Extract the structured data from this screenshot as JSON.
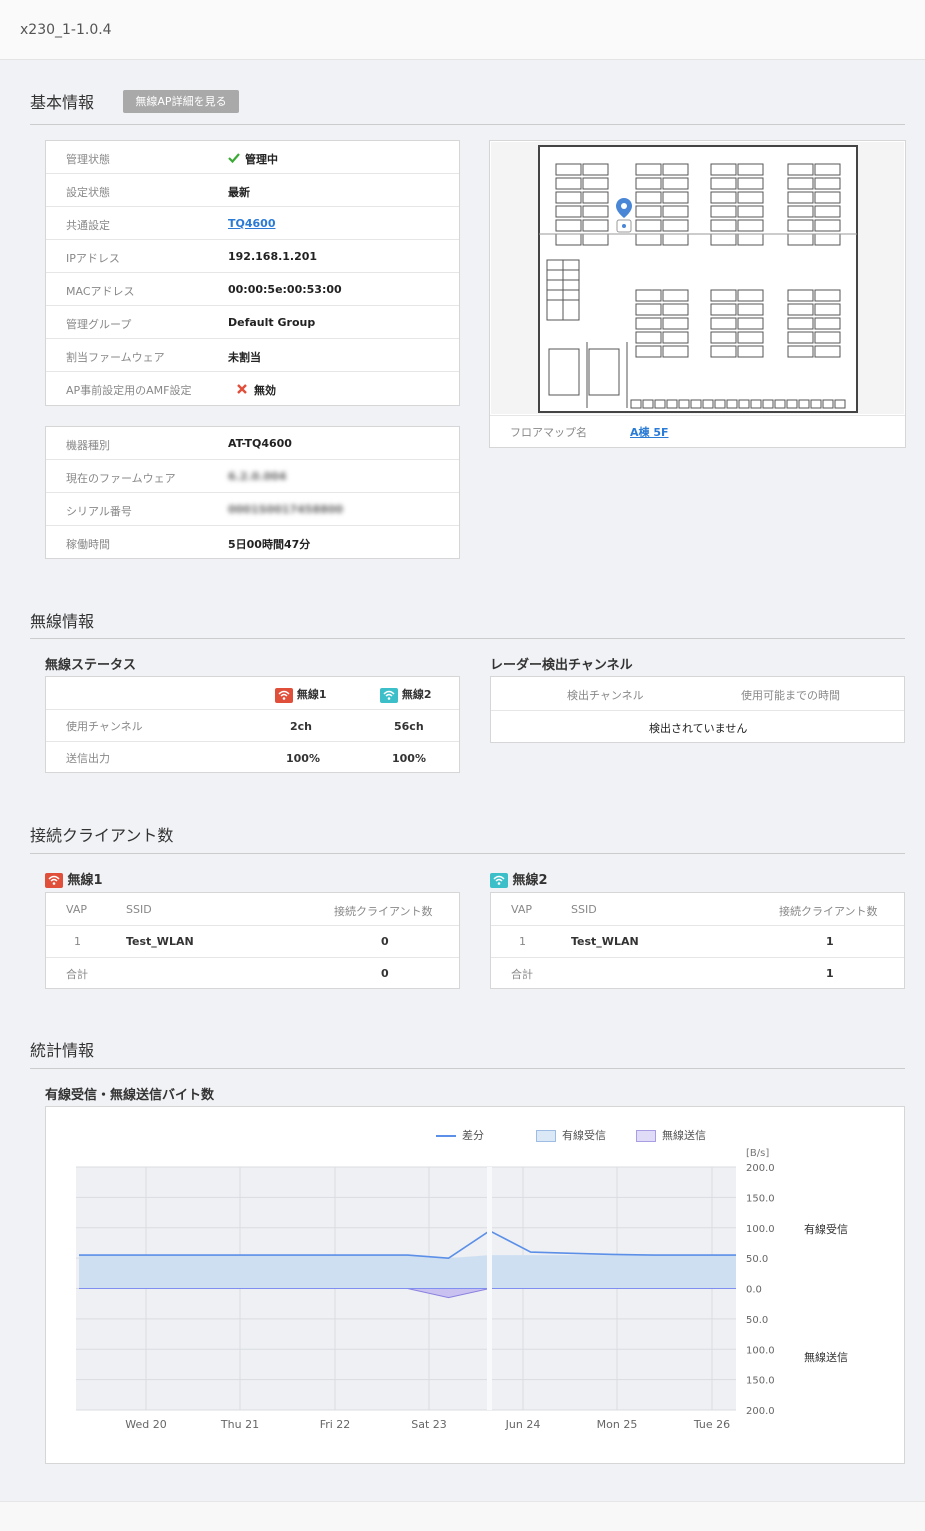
{
  "app": {
    "title": "x230_1-1.0.4"
  },
  "basic": {
    "section_title": "基本情報",
    "detail_button": "無線AP詳細を見る",
    "rows1": [
      {
        "label": "管理状態",
        "value": "管理中"
      },
      {
        "label": "設定状態",
        "value": "最新"
      },
      {
        "label": "共通設定",
        "value": "TQ4600"
      },
      {
        "label": "IPアドレス",
        "value": "192.168.1.201"
      },
      {
        "label": "MACアドレス",
        "value": "00:00:5e:00:53:00"
      },
      {
        "label": "管理グループ",
        "value": "Default Group"
      },
      {
        "label": "割当ファームウェア",
        "value": "未割当"
      },
      {
        "label": "AP事前設定用のAMF設定",
        "value": "無効"
      }
    ],
    "rows2": [
      {
        "label": "機器種別",
        "value": "AT-TQ4600"
      },
      {
        "label": "現在のファームウェア",
        "value": "6.2.0.004"
      },
      {
        "label": "シリアル番号",
        "value": "0001S0017458800"
      },
      {
        "label": "稼働時間",
        "value": "5日00時間47分"
      }
    ],
    "floormap": {
      "label": "フロアマップ名",
      "value": "A棟 5F"
    }
  },
  "wireless": {
    "section_title": "無線情報",
    "status_title": "無線ステータス",
    "radio1": "無線1",
    "radio2": "無線2",
    "rows": [
      {
        "label": "使用チャンネル",
        "r1": "2ch",
        "r2": "56ch"
      },
      {
        "label": "送信出力",
        "r1": "100%",
        "r2": "100%"
      }
    ],
    "radar_title": "レーダー検出チャンネル",
    "radar_col1": "検出チャンネル",
    "radar_col2": "使用可能までの時間",
    "radar_empty": "検出されていません"
  },
  "clients": {
    "section_title": "接続クライアント数",
    "col_vap": "VAP",
    "col_ssid": "SSID",
    "col_count": "接続クライアント数",
    "total_label": "合計",
    "radio1": {
      "name": "無線1",
      "vap": "1",
      "ssid": "Test_WLAN",
      "count": "0",
      "total": "0"
    },
    "radio2": {
      "name": "無線2",
      "vap": "1",
      "ssid": "Test_WLAN",
      "count": "1",
      "total": "1"
    }
  },
  "stats": {
    "section_title": "統計情報",
    "chart_title": "有線受信・無線送信バイト数",
    "legend_diff": "差分",
    "legend_rx": "有線受信",
    "legend_tx": "無線送信",
    "unit": "[B/s]",
    "side_rx": "有線受信",
    "side_tx": "無線送信"
  },
  "colors": {
    "accent_link": "#2a7bd6",
    "check_green": "#3aaa35",
    "cross_red": "#e04f3a",
    "radio1": "#e04f3a",
    "radio2": "#3cbfc9",
    "line": "#5b8fe8",
    "rx_fill": "#cfdff2",
    "tx_fill": "#d9d3f5"
  },
  "chart_data": {
    "type": "area",
    "ylabel": "[B/s]",
    "x_ticks": [
      "Wed 20",
      "Thu 21",
      "Fri 22",
      "Sat 23",
      "Jun 24",
      "Mon 25",
      "Tue 26"
    ],
    "y_ticks_upper": [
      "200.0",
      "150.0",
      "100.0",
      "50.0",
      "0.0"
    ],
    "y_ticks_lower": [
      "50.0",
      "100.0",
      "150.0",
      "200.0"
    ],
    "ylim": [
      -200,
      200
    ],
    "series": [
      {
        "name": "有線受信",
        "values": [
          55,
          55,
          55,
          55,
          55,
          55,
          55,
          55,
          55,
          50,
          55,
          55,
          55,
          55,
          55,
          55,
          55
        ]
      },
      {
        "name": "無線送信",
        "values": [
          0,
          0,
          0,
          0,
          0,
          0,
          0,
          0,
          0,
          -15,
          0,
          0,
          0,
          0,
          0,
          0,
          0
        ]
      },
      {
        "name": "差分",
        "values": [
          55,
          55,
          55,
          55,
          55,
          55,
          55,
          55,
          55,
          50,
          95,
          60,
          58,
          56,
          55,
          55,
          55
        ]
      }
    ],
    "legend": "top"
  }
}
